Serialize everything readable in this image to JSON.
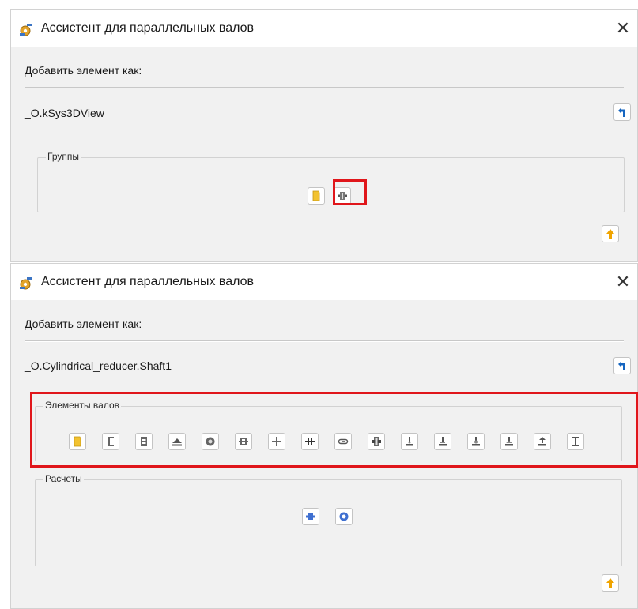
{
  "window1": {
    "title": "Ассистент для параллельных валов",
    "close_label": "✕",
    "add_label": "Добавить элемент как:",
    "path": "_O.kSys3DView",
    "groups": {
      "label": "Группы"
    }
  },
  "window2": {
    "title": "Ассистент для параллельных валов",
    "close_label": "✕",
    "add_label": "Добавить элемент как:",
    "path": "_O.Cylindrical_reducer.Shaft1",
    "shaft_elements": {
      "label": "Элементы валов"
    },
    "calculations": {
      "label": "Расчеты"
    }
  },
  "colors": {
    "highlight": "#e0161b",
    "accent_blue": "#1565c0",
    "folder_yellow": "#f2c230",
    "up_arrow_orange": "#f0a400"
  }
}
